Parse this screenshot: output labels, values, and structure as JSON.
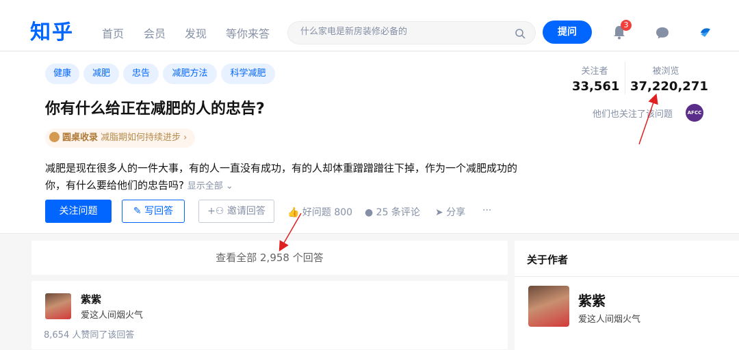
{
  "header": {
    "logo": "知乎",
    "nav": [
      "首页",
      "会员",
      "发现",
      "等你来答"
    ],
    "search_placeholder": "什么家电是新房装修必备的",
    "ask_label": "提问",
    "notification_count": "3"
  },
  "question": {
    "tags": [
      "健康",
      "减肥",
      "忠告",
      "减肥方法",
      "科学减肥"
    ],
    "title": "你有什么给正在减肥的人的忠告?",
    "roundtable_title": "圆桌收录",
    "roundtable_topic": "减脂期如何持续进步",
    "description": "减肥是现在很多人的一件大事，有的人一直没有成功，有的人却体重蹭蹭蹭往下掉，作为一个减肥成功的你，有什么要给他们的忠告吗?",
    "show_all": "显示全部",
    "follow_label": "关注问题",
    "write_answer_label": "写回答",
    "invite_label": "邀请回答",
    "good_question": "好问题 800",
    "comments": "25 条评论",
    "share": "分享",
    "more": "···",
    "followers_label": "关注者",
    "followers_value": "33,561",
    "views_label": "被浏览",
    "views_value": "37,220,271",
    "also_follow": "他们也关注了该问题",
    "afcc_logo": "AFCC"
  },
  "answers": {
    "view_all": "查看全部 2,958 个回答",
    "author_name": "紫紫",
    "author_bio": "爱这人间烟火气",
    "likes": "8,654 人赞同了该回答"
  },
  "sidebar": {
    "heading": "关于作者",
    "author_name": "紫紫",
    "author_bio": "爱这人间烟火气"
  },
  "colors": {
    "brand": "#0066ff",
    "annotation_arrow": "#e02020"
  }
}
